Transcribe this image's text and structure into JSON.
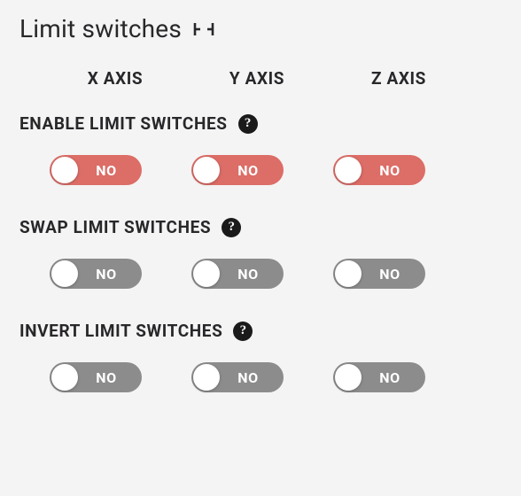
{
  "title": "Limit switches",
  "axes": [
    "X AXIS",
    "Y AXIS",
    "Z AXIS"
  ],
  "settings": {
    "enable": {
      "label": "ENABLE LIMIT SWITCHES",
      "x": "NO",
      "y": "NO",
      "z": "NO"
    },
    "swap": {
      "label": "SWAP LIMIT SWITCHES",
      "x": "NO",
      "y": "NO",
      "z": "NO"
    },
    "invert": {
      "label": "INVERT LIMIT SWITCHES",
      "x": "NO",
      "y": "NO",
      "z": "NO"
    }
  },
  "help_glyph": "?"
}
